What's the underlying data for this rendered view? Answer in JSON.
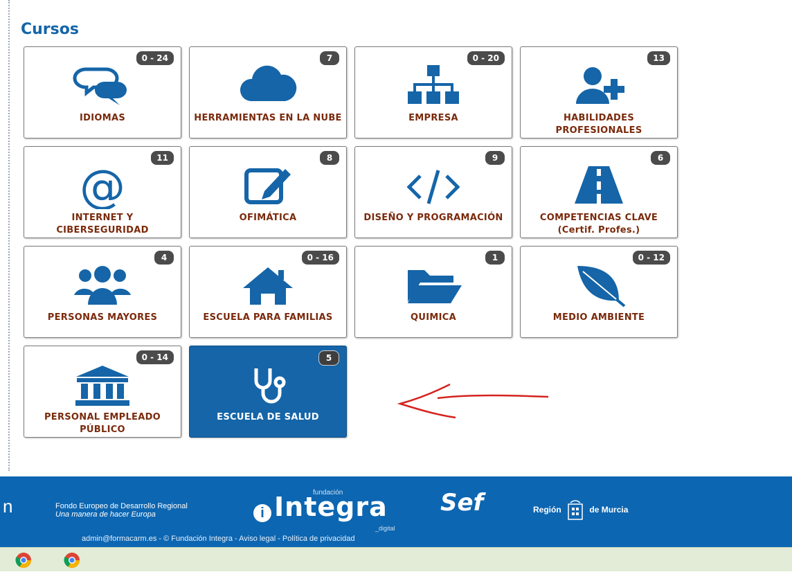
{
  "section_title": "Cursos",
  "tiles": [
    {
      "label": "IDIOMAS",
      "badge": "0 - 24",
      "icon": "chat-bubbles-icon"
    },
    {
      "label": "HERRAMIENTAS EN LA NUBE",
      "badge": "7",
      "icon": "cloud-icon"
    },
    {
      "label": "EMPRESA",
      "badge": "0 - 20",
      "icon": "sitemap-icon"
    },
    {
      "label": "HABILIDADES PROFESIONALES",
      "badge": "13",
      "icon": "user-plus-icon"
    },
    {
      "label": "INTERNET Y CIBERSEGURIDAD",
      "badge": "11",
      "icon": "at-sign-icon"
    },
    {
      "label": "OFIMÁTICA",
      "badge": "8",
      "icon": "edit-icon"
    },
    {
      "label": "DISEÑO Y PROGRAMACIÓN",
      "badge": "9",
      "icon": "code-icon"
    },
    {
      "label": "COMPETENCIAS CLAVE (Certif. Profes.)",
      "badge": "6",
      "icon": "road-icon"
    },
    {
      "label": "PERSONAS MAYORES",
      "badge": "4",
      "icon": "users-icon"
    },
    {
      "label": "ESCUELA PARA FAMILIAS",
      "badge": "0 - 16",
      "icon": "home-icon"
    },
    {
      "label": "QUIMICA",
      "badge": "1",
      "icon": "folder-open-icon"
    },
    {
      "label": "MEDIO AMBIENTE",
      "badge": "0 - 12",
      "icon": "leaf-icon"
    },
    {
      "label": "PERSONAL EMPLEADO PÚBLICO",
      "badge": "0 - 14",
      "icon": "institution-icon"
    },
    {
      "label": "ESCUELA DE SALUD",
      "badge": "5",
      "icon": "stethoscope-icon",
      "active": true
    }
  ],
  "footer": {
    "partial_text": "n",
    "feder_line1": "Fondo Europeo de Desarrollo Regional",
    "feder_line2": "Una manera de hacer Europa",
    "integra_small": "fundación",
    "integra_name": "Integra",
    "integra_sub": "_digital",
    "sef_name": "Sef",
    "region_left": "Región",
    "region_right": "de Murcia",
    "links": "admin@formacarm.es - © Fundación Integra - Aviso legal - Política de privacidad"
  },
  "colors": {
    "brand": "#1565a8",
    "label": "#7a2a0c",
    "footer": "#0d66b1"
  }
}
